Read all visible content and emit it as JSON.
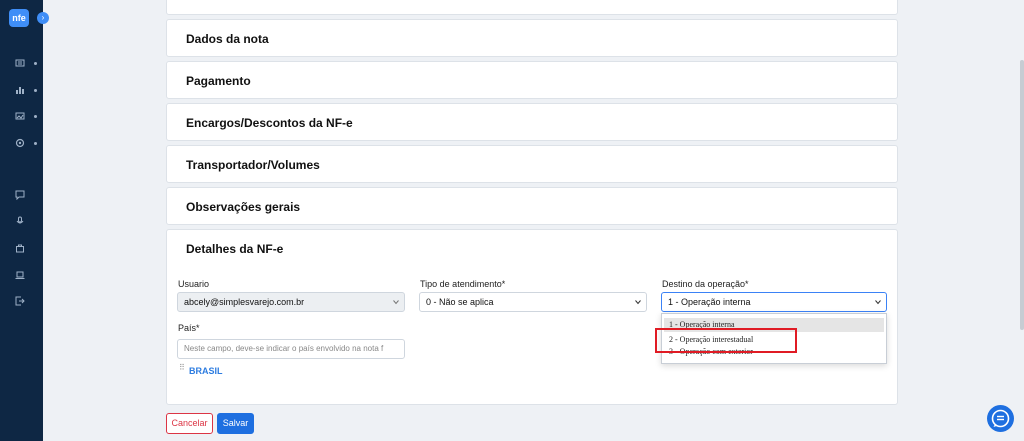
{
  "sidebar": {
    "logo_text": "nfe",
    "toggle_glyph": "›",
    "icons": [
      "list-icon",
      "chart-icon",
      "image-icon",
      "settings-icon",
      "message-icon",
      "microphone-icon",
      "bag-icon",
      "laptop-icon",
      "logout-icon"
    ]
  },
  "sections": [
    {
      "title": ""
    },
    {
      "title": "Dados da nota"
    },
    {
      "title": "Pagamento"
    },
    {
      "title": "Encargos/Descontos da NF-e"
    },
    {
      "title": "Transportador/Volumes"
    },
    {
      "title": "Observações gerais"
    }
  ],
  "details": {
    "title": "Detalhes da NF-e",
    "usuario_label": "Usuario",
    "usuario_value": "abcely@simplesvarejo.com.br",
    "tipo_label": "Tipo de atendimento*",
    "tipo_value": "0 - Não se aplica",
    "destino_label": "Destino da operação*",
    "destino_value": "1 - Operação interna",
    "pais_label": "País*",
    "pais_placeholder": "Neste campo, deve-se indicar o país envolvido na nota f",
    "pais_selected": "BRASIL",
    "destino_options": [
      "1 - Operação interna",
      "2 - Operação interestadual",
      "3 - Operação com exterior"
    ]
  },
  "buttons": {
    "cancel": "Cancelar",
    "save": "Salvar"
  },
  "colors": {
    "sidebar": "#0e2744",
    "primary": "#1e6fe0",
    "danger": "#dc3545",
    "highlight": "#e01b24"
  }
}
